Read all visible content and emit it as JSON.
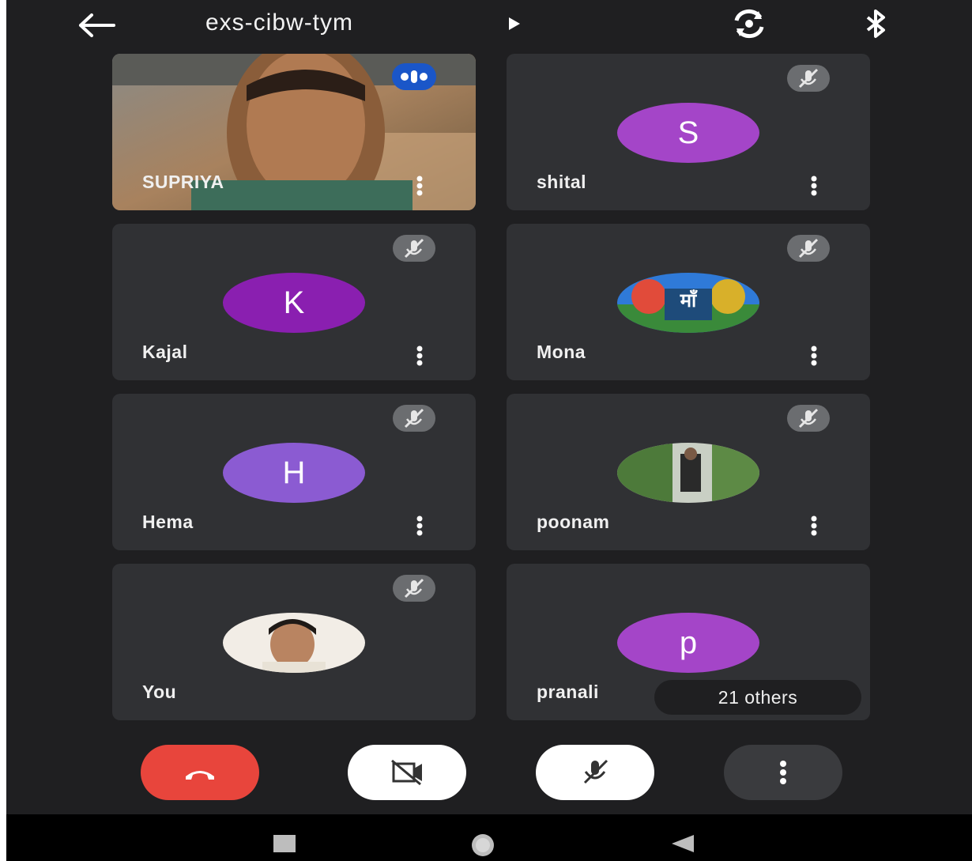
{
  "meeting": {
    "code": "exs-cibw-tym"
  },
  "participants": [
    {
      "name": "SUPRIYA",
      "initial": "",
      "type": "video",
      "speaking": true
    },
    {
      "name": "shital",
      "initial": "S",
      "type": "initial",
      "color": "#a445c8"
    },
    {
      "name": "Kajal",
      "initial": "K",
      "type": "initial",
      "color": "#8a1fb0"
    },
    {
      "name": "Mona",
      "initial": "",
      "type": "photo"
    },
    {
      "name": "Hema",
      "initial": "H",
      "type": "initial",
      "color": "#8b5bd2"
    },
    {
      "name": "poonam",
      "initial": "",
      "type": "photo"
    },
    {
      "name": "You",
      "initial": "",
      "type": "photo"
    },
    {
      "name": "pranali",
      "initial": "p",
      "type": "initial",
      "color": "#a445c8"
    }
  ],
  "others_label": "21 others",
  "mona_avatar_text": "माँ",
  "icons": {
    "back": "arrow-left-icon",
    "switch_camera": "camera-switch-icon",
    "bluetooth": "bluetooth-icon",
    "muted": "mic-off-icon",
    "menu": "more-vert-icon",
    "speaking": "speaking-indicator-icon",
    "hangup": "phone-hangup-icon",
    "camera_off": "video-off-icon",
    "more": "more-vert-icon"
  },
  "colors": {
    "hangup": "#e8453c",
    "speaking": "#1a56c8",
    "tile": "#303134",
    "background": "#1f1f21"
  }
}
